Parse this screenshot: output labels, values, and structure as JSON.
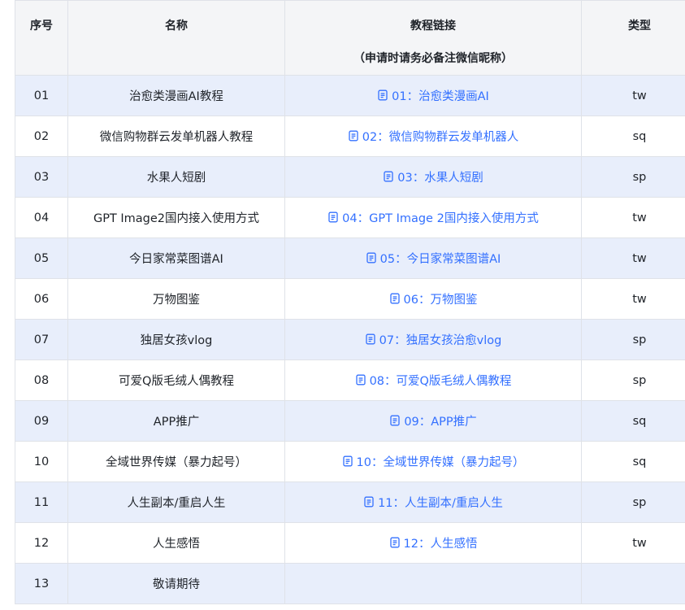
{
  "table": {
    "headers": {
      "num": "序号",
      "name": "名称",
      "link_title": "教程链接",
      "link_subtitle": "（申请时请务必备注微信昵称）",
      "type": "类型"
    },
    "link_icon": "doc-icon",
    "link_color": "#3370ff",
    "rows": [
      {
        "num": "01",
        "name": "治愈类漫画AI教程",
        "link": "01：治愈类漫画AI",
        "type": "tw"
      },
      {
        "num": "02",
        "name": "微信购物群云发单机器人教程",
        "link": "02：微信购物群云发单机器人",
        "type": "sq"
      },
      {
        "num": "03",
        "name": "水果人短剧",
        "link": "03：水果人短剧",
        "type": "sp"
      },
      {
        "num": "04",
        "name": "GPT Image2国内接入使用方式",
        "link": "04：GPT Image 2国内接入使用方式",
        "type": "tw"
      },
      {
        "num": "05",
        "name": "今日家常菜图谱AI",
        "link": "05：今日家常菜图谱AI",
        "type": "tw"
      },
      {
        "num": "06",
        "name": "万物图鉴",
        "link": "06：万物图鉴",
        "type": "tw"
      },
      {
        "num": "07",
        "name": "独居女孩vlog",
        "link": "07：独居女孩治愈vlog",
        "type": "sp"
      },
      {
        "num": "08",
        "name": "可爱Q版毛绒人偶教程",
        "link": "08：可爱Q版毛绒人偶教程",
        "type": "sp"
      },
      {
        "num": "09",
        "name": "APP推广",
        "link": "09：APP推广",
        "type": "sq"
      },
      {
        "num": "10",
        "name": "全域世界传媒（暴力起号）",
        "link": "10：全域世界传媒（暴力起号）",
        "type": "sq"
      },
      {
        "num": "11",
        "name": "人生副本/重启人生",
        "link": "11：人生副本/重启人生",
        "type": "sp"
      },
      {
        "num": "12",
        "name": "人生感悟",
        "link": "12：人生感悟",
        "type": "tw"
      },
      {
        "num": "13",
        "name": "敬请期待",
        "link": "",
        "type": ""
      }
    ]
  }
}
